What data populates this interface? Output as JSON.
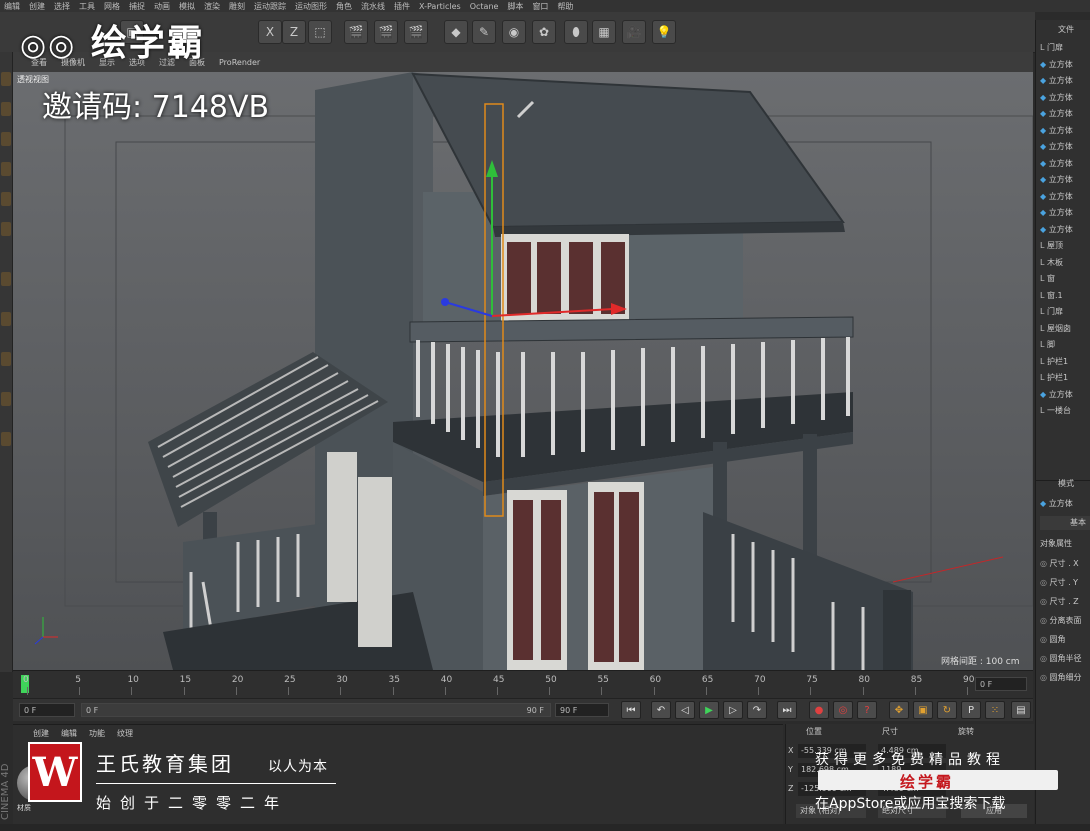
{
  "menu": [
    "编辑",
    "创建",
    "选择",
    "工具",
    "网格",
    "捕捉",
    "动画",
    "模拟",
    "渲染",
    "雕刻",
    "运动跟踪",
    "运动图形",
    "角色",
    "流水线",
    "插件",
    "X-Particles",
    "Octane",
    "脚本",
    "窗口",
    "帮助"
  ],
  "viewport": {
    "tabs": [
      "查看",
      "摄像机",
      "显示",
      "选项",
      "过滤",
      "面板",
      "ProRender"
    ],
    "name": "透视视图",
    "grid_spacing": "网格间距 : 100 cm"
  },
  "timeline": {
    "ticks": [
      "0",
      "5",
      "10",
      "15",
      "20",
      "25",
      "30",
      "35",
      "40",
      "45",
      "50",
      "55",
      "60",
      "65",
      "70",
      "75",
      "80",
      "85",
      "90"
    ],
    "current_frame": "0 F",
    "start_field": "0 F",
    "range_start": "0 F",
    "range_end": "90 F",
    "end_field": "90 F"
  },
  "object_manager": {
    "tab": "文件",
    "items": [
      "门扉",
      "立方体",
      "立方体",
      "立方体",
      "立方体",
      "立方体",
      "立方体",
      "立方体",
      "立方体",
      "立方体",
      "立方体",
      "立方体",
      "屋顶",
      "木板",
      "窗",
      "窗.1",
      "门扉",
      "屋烟囱",
      "脚",
      "护栏1",
      "护栏1",
      "立方体",
      "一楼台"
    ]
  },
  "attributes": {
    "tab": "模式",
    "object": "立方体",
    "section_tab": "基本",
    "group": "对象属性",
    "props": [
      "尺寸 . X",
      "尺寸 . Y",
      "尺寸 . Z",
      "分离表面",
      "圆角",
      "圆角半径",
      "圆角细分"
    ]
  },
  "material": {
    "tabs": [
      "创建",
      "编辑",
      "功能",
      "纹理"
    ],
    "item": "材质"
  },
  "coords": {
    "headers": [
      "位置",
      "尺寸",
      "旋转"
    ],
    "rows": [
      {
        "axis": "X",
        "pos": "-55.339 cm",
        "size": "4.489 cm"
      },
      {
        "axis": "Y",
        "pos": "182.698 cm",
        "size": "1189"
      },
      {
        "axis": "Z",
        "pos": "-125.909 cm",
        "size": "4.489 cm"
      }
    ],
    "mode1": "对象 (相对)",
    "mode2": "绝对尺寸",
    "apply": "应用"
  },
  "watermark": {
    "logo": "绘学霸",
    "invite": "邀请码: 7148VB",
    "brand_letter": "W",
    "brand_name": "王氏教育集团",
    "brand_slogan": "以人为本",
    "brand_founded": "始创于二零零二年",
    "promo_line1": "获得更多免费精品教程",
    "promo_brand": "绘学霸",
    "promo_line3": "在AppStore或应用宝搜索下载"
  },
  "side_label": "CINEMA 4D"
}
